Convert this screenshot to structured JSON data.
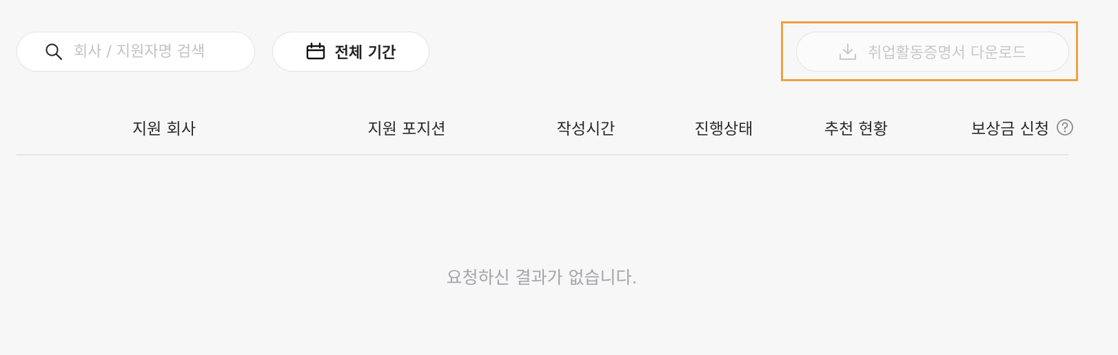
{
  "toolbar": {
    "search": {
      "placeholder": "회사 / 지원자명 검색",
      "value": "",
      "icon": "search-icon"
    },
    "period_button": {
      "label": "전체 기간",
      "icon": "calendar-icon"
    },
    "download_button": {
      "label": "취업활동증명서 다운로드",
      "icon": "download-icon",
      "enabled": false
    }
  },
  "table": {
    "columns": [
      "지원 회사",
      "지원 포지션",
      "작성시간",
      "진행상태",
      "추천 현황",
      "보상금 신청"
    ],
    "help_icon": "question-circle-icon",
    "empty_message": "요청하신 결과가 없습니다."
  },
  "colors": {
    "background": "#f7f7f8",
    "highlight": "#f0a040",
    "muted_text": "#a5a5aa",
    "disabled_text": "#c8c8cc"
  }
}
